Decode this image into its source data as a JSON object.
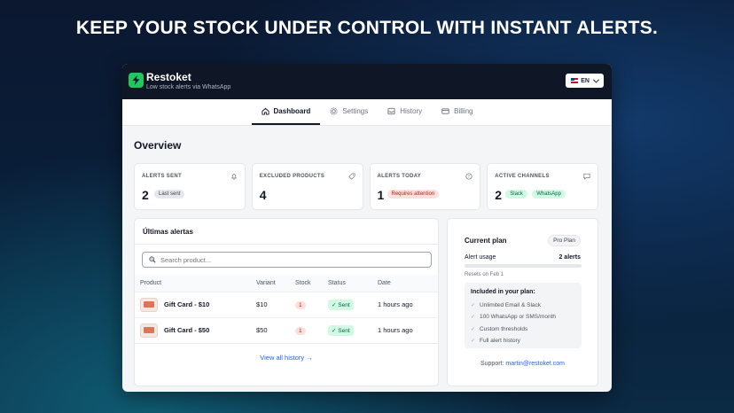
{
  "headline": "KEEP YOUR STOCK UNDER CONTROL WITH INSTANT ALERTS.",
  "app": {
    "name": "Restoket",
    "tagline": "Low stock alerts via WhatsApp",
    "language": "EN",
    "accent_color": "#22c55e"
  },
  "tabs": [
    {
      "label": "Dashboard",
      "icon": "home-icon",
      "active": true
    },
    {
      "label": "Settings",
      "icon": "gear-icon",
      "active": false
    },
    {
      "label": "History",
      "icon": "inbox-icon",
      "active": false
    },
    {
      "label": "Billing",
      "icon": "credit-card-icon",
      "active": false
    }
  ],
  "overview": {
    "title": "Overview",
    "cards": [
      {
        "label": "ALERTS SENT",
        "value": "2",
        "badge": "Last sent",
        "icon": "bell-icon"
      },
      {
        "label": "EXCLUDED PRODUCTS",
        "value": "4",
        "badge": "",
        "icon": "tag-icon"
      },
      {
        "label": "ALERTS TODAY",
        "value": "1",
        "badge": "Requires attention",
        "icon": "info-icon"
      },
      {
        "label": "ACTIVE CHANNELS",
        "value": "2",
        "badges": [
          "Slack",
          "WhatsApp"
        ],
        "icon": "chat-icon"
      }
    ]
  },
  "alerts": {
    "title": "Últimas alertas",
    "search_placeholder": "Search product...",
    "columns": [
      "Product",
      "Variant",
      "Stock",
      "Status",
      "Date"
    ],
    "rows": [
      {
        "product": "Gift Card - $10",
        "variant": "$10",
        "stock": "1",
        "status": "✓ Sent",
        "date": "1 hours ago"
      },
      {
        "product": "Gift Card - $50",
        "variant": "$50",
        "stock": "1",
        "status": "✓ Sent",
        "date": "1 hours ago"
      }
    ],
    "view_all": "View all history →"
  },
  "plan": {
    "title": "Current plan",
    "badge": "Pro Plan",
    "usage_label": "Alert usage",
    "usage_value": "2 alerts",
    "usage_fraction": 0.0,
    "resets": "Resets on Feb 1",
    "included_title": "Included in your plan:",
    "features": [
      "Unlimited Email & Slack",
      "100 WhatsApp or SMS/month",
      "Custom thresholds",
      "Full alert history"
    ],
    "support_label": "Support:",
    "support_email": "martin@restoket.com"
  }
}
